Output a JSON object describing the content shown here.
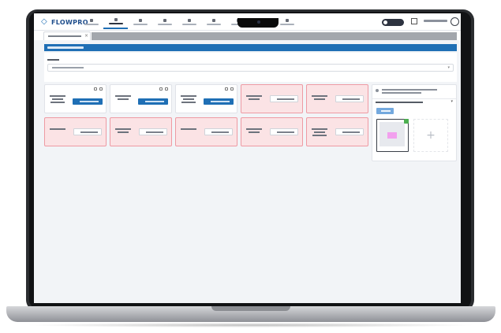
{
  "app": {
    "brand": "FLOWPRO",
    "brand_color": "#1f6fb5"
  },
  "nav": {
    "items": [
      {
        "icon": "home-icon",
        "active": false
      },
      {
        "icon": "document-icon",
        "active": true
      },
      {
        "icon": "list-icon",
        "active": false
      },
      {
        "icon": "people-icon",
        "active": false
      },
      {
        "icon": "person-icon",
        "active": false
      },
      {
        "icon": "gear-icon",
        "active": false
      },
      {
        "icon": "chart-icon",
        "active": false
      },
      {
        "icon": "file-icon",
        "active": false
      },
      {
        "icon": "report-icon",
        "active": false
      }
    ]
  },
  "tabs": [
    {
      "close": "×",
      "active": true
    }
  ],
  "section": {
    "header_color": "#1f6fb5"
  },
  "cards": {
    "row1": [
      {
        "state": "normal",
        "button": "primary"
      },
      {
        "state": "normal",
        "button": "primary"
      },
      {
        "state": "normal",
        "button": "primary"
      },
      {
        "state": "missing",
        "button": "file"
      },
      {
        "state": "missing",
        "button": "file"
      }
    ],
    "row2": [
      {
        "state": "missing",
        "button": "file"
      },
      {
        "state": "missing",
        "button": "file"
      },
      {
        "state": "missing",
        "button": "file"
      },
      {
        "state": "missing",
        "button": "file"
      },
      {
        "state": "missing",
        "button": "file"
      }
    ]
  },
  "side_panel": {
    "add_symbol": "+"
  },
  "colors": {
    "missing_bg": "#fbe3e5",
    "missing_border": "#ee9aa3",
    "primary": "#1f6fb5"
  }
}
